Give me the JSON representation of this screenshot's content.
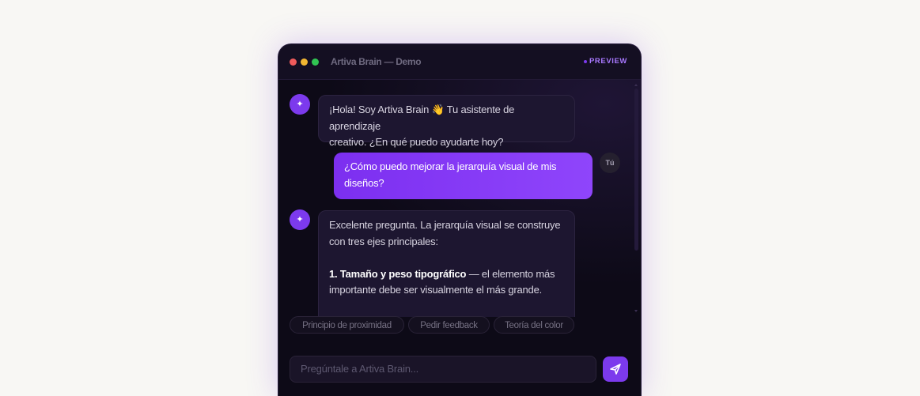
{
  "window": {
    "title": "Artiva Brain — Demo",
    "badge": "PREVIEW"
  },
  "messages": [
    {
      "role": "bot",
      "avatar_icon": "sparkle-icon",
      "line1": "¡Hola! Soy Artiva Brain 👋 Tu asistente de aprendizaje",
      "line2": "creativo. ¿En qué puedo ayudarte hoy?"
    },
    {
      "role": "user",
      "avatar_label": "Tú",
      "line1": "¿Cómo puedo mejorar la jerarquía visual de mis",
      "line2": "diseños?"
    },
    {
      "role": "bot",
      "avatar_icon": "sparkle-icon",
      "line1": "Excelente pregunta. La jerarquía visual se construye",
      "line2": "con tres ejes principales:",
      "point_bold": "1. Tamaño y peso tipográfico",
      "point_rest": " — el elemento más",
      "point_line2": "importante debe ser visualmente el más grande."
    }
  ],
  "suggestions": [
    "Principio de proximidad",
    "Pedir feedback",
    "Teoría del color"
  ],
  "composer": {
    "placeholder": "Pregúntale a Artiva Brain...",
    "send_icon": "send-icon"
  },
  "colors": {
    "accent": "#7c3aed",
    "background": "#0d0a17",
    "page": "#f8f7f4"
  }
}
